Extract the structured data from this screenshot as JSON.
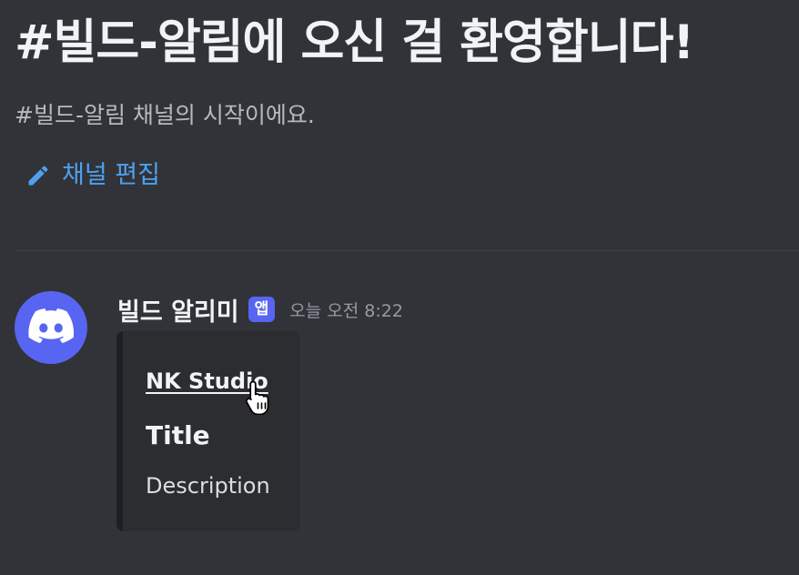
{
  "channel_intro": {
    "title": "#빌드-알림에 오신 걸 환영합니다!",
    "subtitle": "#빌드-알림 채널의 시작이에요.",
    "edit_label": "채널 편집",
    "edit_icon": "pencil-icon"
  },
  "message": {
    "avatar_icon": "discord-logo-icon",
    "avatar_color": "#5865f2",
    "username": "빌드 알리미",
    "badge": "앱",
    "timestamp": "오늘 오전 8:22",
    "embed": {
      "author": "NK Studio",
      "title": "Title",
      "description": "Description"
    }
  },
  "colors": {
    "background": "#313338",
    "link": "#4fa0ee",
    "embed_background": "#2b2d31",
    "badge": "#5865f2"
  }
}
